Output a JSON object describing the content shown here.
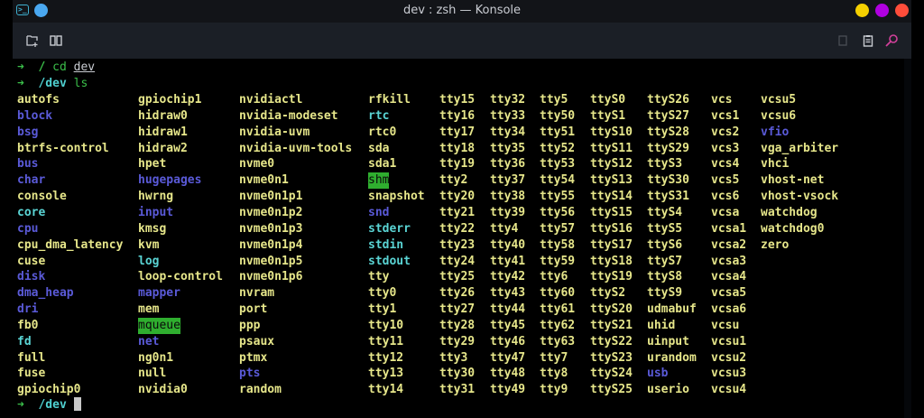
{
  "window": {
    "title": "dev : zsh — Konsole",
    "controls": {
      "minimize_color": "#f5d000",
      "maximize_color": "#b000e0",
      "close_color": "#ff4d3a"
    }
  },
  "toolbar": {
    "left": [
      "new-tab-icon",
      "split-view-icon"
    ],
    "right": [
      "copy-icon",
      "paste-icon",
      "find-icon"
    ]
  },
  "terminal": {
    "history": [
      {
        "arrow": "➜",
        "cwd": "/",
        "cmd": "cd",
        "arg": "dev"
      },
      {
        "arrow": "➜",
        "cwd": "/dev",
        "cmd": "ls",
        "arg": ""
      }
    ],
    "prompt": {
      "arrow": "➜",
      "cwd": "/dev"
    },
    "colors": {
      "file": "#e6e68a",
      "dir": "#5a5ad8",
      "link": "#5ad4d4",
      "sticky": "#2fae2f"
    },
    "columns": [
      [
        {
          "n": "autofs",
          "t": "y"
        },
        {
          "n": "block",
          "t": "b"
        },
        {
          "n": "bsg",
          "t": "b"
        },
        {
          "n": "btrfs-control",
          "t": "y"
        },
        {
          "n": "bus",
          "t": "b"
        },
        {
          "n": "char",
          "t": "b"
        },
        {
          "n": "console",
          "t": "y"
        },
        {
          "n": "core",
          "t": "c"
        },
        {
          "n": "cpu",
          "t": "b"
        },
        {
          "n": "cpu_dma_latency",
          "t": "y"
        },
        {
          "n": "cuse",
          "t": "y"
        },
        {
          "n": "disk",
          "t": "b"
        },
        {
          "n": "dma_heap",
          "t": "b"
        },
        {
          "n": "dri",
          "t": "b"
        },
        {
          "n": "fb0",
          "t": "y"
        },
        {
          "n": "fd",
          "t": "c"
        },
        {
          "n": "full",
          "t": "y"
        },
        {
          "n": "fuse",
          "t": "y"
        },
        {
          "n": "gpiochip0",
          "t": "y"
        }
      ],
      [
        {
          "n": "gpiochip1",
          "t": "y"
        },
        {
          "n": "hidraw0",
          "t": "y"
        },
        {
          "n": "hidraw1",
          "t": "y"
        },
        {
          "n": "hidraw2",
          "t": "y"
        },
        {
          "n": "hpet",
          "t": "y"
        },
        {
          "n": "hugepages",
          "t": "b"
        },
        {
          "n": "hwrng",
          "t": "y"
        },
        {
          "n": "input",
          "t": "b"
        },
        {
          "n": "kmsg",
          "t": "y"
        },
        {
          "n": "kvm",
          "t": "y"
        },
        {
          "n": "log",
          "t": "c"
        },
        {
          "n": "loop-control",
          "t": "y"
        },
        {
          "n": "mapper",
          "t": "b"
        },
        {
          "n": "mem",
          "t": "y"
        },
        {
          "n": "mqueue",
          "t": "g"
        },
        {
          "n": "net",
          "t": "b"
        },
        {
          "n": "ng0n1",
          "t": "y"
        },
        {
          "n": "null",
          "t": "y"
        },
        {
          "n": "nvidia0",
          "t": "y"
        }
      ],
      [
        {
          "n": "nvidiactl",
          "t": "y"
        },
        {
          "n": "nvidia-modeset",
          "t": "y"
        },
        {
          "n": "nvidia-uvm",
          "t": "y"
        },
        {
          "n": "nvidia-uvm-tools",
          "t": "y"
        },
        {
          "n": "nvme0",
          "t": "y"
        },
        {
          "n": "nvme0n1",
          "t": "y"
        },
        {
          "n": "nvme0n1p1",
          "t": "y"
        },
        {
          "n": "nvme0n1p2",
          "t": "y"
        },
        {
          "n": "nvme0n1p3",
          "t": "y"
        },
        {
          "n": "nvme0n1p4",
          "t": "y"
        },
        {
          "n": "nvme0n1p5",
          "t": "y"
        },
        {
          "n": "nvme0n1p6",
          "t": "y"
        },
        {
          "n": "nvram",
          "t": "y"
        },
        {
          "n": "port",
          "t": "y"
        },
        {
          "n": "ppp",
          "t": "y"
        },
        {
          "n": "psaux",
          "t": "y"
        },
        {
          "n": "ptmx",
          "t": "y"
        },
        {
          "n": "pts",
          "t": "b"
        },
        {
          "n": "random",
          "t": "y"
        }
      ],
      [
        {
          "n": "rfkill",
          "t": "y"
        },
        {
          "n": "rtc",
          "t": "c"
        },
        {
          "n": "rtc0",
          "t": "y"
        },
        {
          "n": "sda",
          "t": "y"
        },
        {
          "n": "sda1",
          "t": "y"
        },
        {
          "n": "shm",
          "t": "g"
        },
        {
          "n": "snapshot",
          "t": "y"
        },
        {
          "n": "snd",
          "t": "b"
        },
        {
          "n": "stderr",
          "t": "c"
        },
        {
          "n": "stdin",
          "t": "c"
        },
        {
          "n": "stdout",
          "t": "c"
        },
        {
          "n": "tty",
          "t": "y"
        },
        {
          "n": "tty0",
          "t": "y"
        },
        {
          "n": "tty1",
          "t": "y"
        },
        {
          "n": "tty10",
          "t": "y"
        },
        {
          "n": "tty11",
          "t": "y"
        },
        {
          "n": "tty12",
          "t": "y"
        },
        {
          "n": "tty13",
          "t": "y"
        },
        {
          "n": "tty14",
          "t": "y"
        }
      ],
      [
        {
          "n": "tty15",
          "t": "y"
        },
        {
          "n": "tty16",
          "t": "y"
        },
        {
          "n": "tty17",
          "t": "y"
        },
        {
          "n": "tty18",
          "t": "y"
        },
        {
          "n": "tty19",
          "t": "y"
        },
        {
          "n": "tty2",
          "t": "y"
        },
        {
          "n": "tty20",
          "t": "y"
        },
        {
          "n": "tty21",
          "t": "y"
        },
        {
          "n": "tty22",
          "t": "y"
        },
        {
          "n": "tty23",
          "t": "y"
        },
        {
          "n": "tty24",
          "t": "y"
        },
        {
          "n": "tty25",
          "t": "y"
        },
        {
          "n": "tty26",
          "t": "y"
        },
        {
          "n": "tty27",
          "t": "y"
        },
        {
          "n": "tty28",
          "t": "y"
        },
        {
          "n": "tty29",
          "t": "y"
        },
        {
          "n": "tty3",
          "t": "y"
        },
        {
          "n": "tty30",
          "t": "y"
        },
        {
          "n": "tty31",
          "t": "y"
        }
      ],
      [
        {
          "n": "tty32",
          "t": "y"
        },
        {
          "n": "tty33",
          "t": "y"
        },
        {
          "n": "tty34",
          "t": "y"
        },
        {
          "n": "tty35",
          "t": "y"
        },
        {
          "n": "tty36",
          "t": "y"
        },
        {
          "n": "tty37",
          "t": "y"
        },
        {
          "n": "tty38",
          "t": "y"
        },
        {
          "n": "tty39",
          "t": "y"
        },
        {
          "n": "tty4",
          "t": "y"
        },
        {
          "n": "tty40",
          "t": "y"
        },
        {
          "n": "tty41",
          "t": "y"
        },
        {
          "n": "tty42",
          "t": "y"
        },
        {
          "n": "tty43",
          "t": "y"
        },
        {
          "n": "tty44",
          "t": "y"
        },
        {
          "n": "tty45",
          "t": "y"
        },
        {
          "n": "tty46",
          "t": "y"
        },
        {
          "n": "tty47",
          "t": "y"
        },
        {
          "n": "tty48",
          "t": "y"
        },
        {
          "n": "tty49",
          "t": "y"
        }
      ],
      [
        {
          "n": "tty5",
          "t": "y"
        },
        {
          "n": "tty50",
          "t": "y"
        },
        {
          "n": "tty51",
          "t": "y"
        },
        {
          "n": "tty52",
          "t": "y"
        },
        {
          "n": "tty53",
          "t": "y"
        },
        {
          "n": "tty54",
          "t": "y"
        },
        {
          "n": "tty55",
          "t": "y"
        },
        {
          "n": "tty56",
          "t": "y"
        },
        {
          "n": "tty57",
          "t": "y"
        },
        {
          "n": "tty58",
          "t": "y"
        },
        {
          "n": "tty59",
          "t": "y"
        },
        {
          "n": "tty6",
          "t": "y"
        },
        {
          "n": "tty60",
          "t": "y"
        },
        {
          "n": "tty61",
          "t": "y"
        },
        {
          "n": "tty62",
          "t": "y"
        },
        {
          "n": "tty63",
          "t": "y"
        },
        {
          "n": "tty7",
          "t": "y"
        },
        {
          "n": "tty8",
          "t": "y"
        },
        {
          "n": "tty9",
          "t": "y"
        }
      ],
      [
        {
          "n": "ttyS0",
          "t": "y"
        },
        {
          "n": "ttyS1",
          "t": "y"
        },
        {
          "n": "ttyS10",
          "t": "y"
        },
        {
          "n": "ttyS11",
          "t": "y"
        },
        {
          "n": "ttyS12",
          "t": "y"
        },
        {
          "n": "ttyS13",
          "t": "y"
        },
        {
          "n": "ttyS14",
          "t": "y"
        },
        {
          "n": "ttyS15",
          "t": "y"
        },
        {
          "n": "ttyS16",
          "t": "y"
        },
        {
          "n": "ttyS17",
          "t": "y"
        },
        {
          "n": "ttyS18",
          "t": "y"
        },
        {
          "n": "ttyS19",
          "t": "y"
        },
        {
          "n": "ttyS2",
          "t": "y"
        },
        {
          "n": "ttyS20",
          "t": "y"
        },
        {
          "n": "ttyS21",
          "t": "y"
        },
        {
          "n": "ttyS22",
          "t": "y"
        },
        {
          "n": "ttyS23",
          "t": "y"
        },
        {
          "n": "ttyS24",
          "t": "y"
        },
        {
          "n": "ttyS25",
          "t": "y"
        }
      ],
      [
        {
          "n": "ttyS26",
          "t": "y"
        },
        {
          "n": "ttyS27",
          "t": "y"
        },
        {
          "n": "ttyS28",
          "t": "y"
        },
        {
          "n": "ttyS29",
          "t": "y"
        },
        {
          "n": "ttyS3",
          "t": "y"
        },
        {
          "n": "ttyS30",
          "t": "y"
        },
        {
          "n": "ttyS31",
          "t": "y"
        },
        {
          "n": "ttyS4",
          "t": "y"
        },
        {
          "n": "ttyS5",
          "t": "y"
        },
        {
          "n": "ttyS6",
          "t": "y"
        },
        {
          "n": "ttyS7",
          "t": "y"
        },
        {
          "n": "ttyS8",
          "t": "y"
        },
        {
          "n": "ttyS9",
          "t": "y"
        },
        {
          "n": "udmabuf",
          "t": "y"
        },
        {
          "n": "uhid",
          "t": "y"
        },
        {
          "n": "uinput",
          "t": "y"
        },
        {
          "n": "urandom",
          "t": "y"
        },
        {
          "n": "usb",
          "t": "b"
        },
        {
          "n": "userio",
          "t": "y"
        }
      ],
      [
        {
          "n": "vcs",
          "t": "y"
        },
        {
          "n": "vcs1",
          "t": "y"
        },
        {
          "n": "vcs2",
          "t": "y"
        },
        {
          "n": "vcs3",
          "t": "y"
        },
        {
          "n": "vcs4",
          "t": "y"
        },
        {
          "n": "vcs5",
          "t": "y"
        },
        {
          "n": "vcs6",
          "t": "y"
        },
        {
          "n": "vcsa",
          "t": "y"
        },
        {
          "n": "vcsa1",
          "t": "y"
        },
        {
          "n": "vcsa2",
          "t": "y"
        },
        {
          "n": "vcsa3",
          "t": "y"
        },
        {
          "n": "vcsa4",
          "t": "y"
        },
        {
          "n": "vcsa5",
          "t": "y"
        },
        {
          "n": "vcsa6",
          "t": "y"
        },
        {
          "n": "vcsu",
          "t": "y"
        },
        {
          "n": "vcsu1",
          "t": "y"
        },
        {
          "n": "vcsu2",
          "t": "y"
        },
        {
          "n": "vcsu3",
          "t": "y"
        },
        {
          "n": "vcsu4",
          "t": "y"
        }
      ],
      [
        {
          "n": "vcsu5",
          "t": "y"
        },
        {
          "n": "vcsu6",
          "t": "y"
        },
        {
          "n": "vfio",
          "t": "b"
        },
        {
          "n": "vga_arbiter",
          "t": "y"
        },
        {
          "n": "vhci",
          "t": "y"
        },
        {
          "n": "vhost-net",
          "t": "y"
        },
        {
          "n": "vhost-vsock",
          "t": "y"
        },
        {
          "n": "watchdog",
          "t": "y"
        },
        {
          "n": "watchdog0",
          "t": "y"
        },
        {
          "n": "zero",
          "t": "y"
        }
      ]
    ]
  }
}
